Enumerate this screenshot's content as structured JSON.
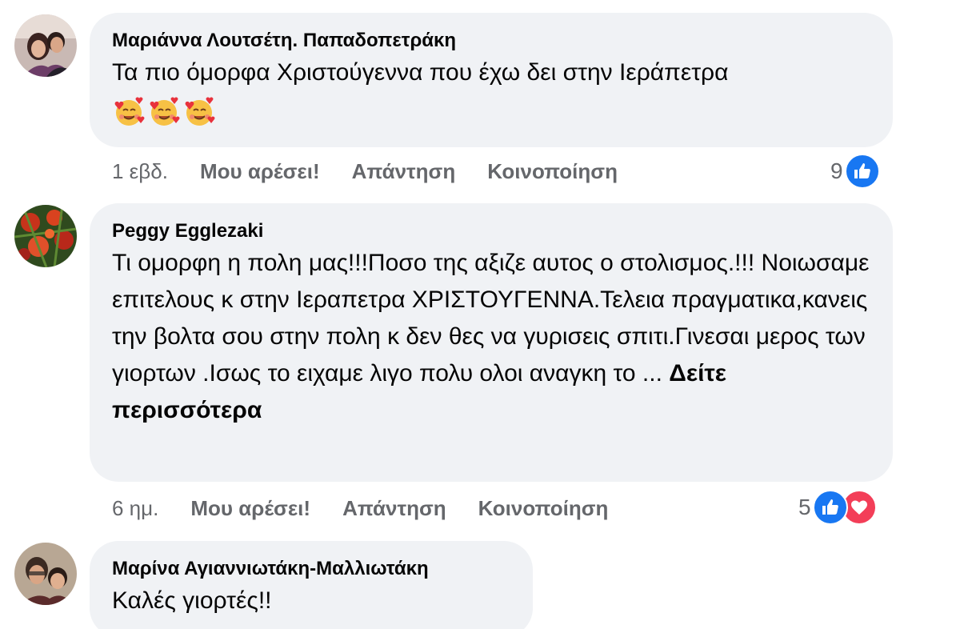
{
  "comments": [
    {
      "author": "Μαριάννα Λουτσέτη. Παπαδοπετράκη",
      "text": "Τα πιο όμορφα Χριστούγεννα που έχω δει στην Ιεράπετρα",
      "emojis": [
        "smiling-face-with-hearts",
        "smiling-face-with-hearts",
        "smiling-face-with-hearts"
      ],
      "time": "1 εβδ.",
      "like_label": "Μου αρέσει!",
      "reply_label": "Απάντηση",
      "share_label": "Κοινοποίηση",
      "reaction_count": "9",
      "reaction_icons": [
        "like-icon"
      ]
    },
    {
      "author": "Peggy Egglezaki",
      "text": "Τι ομορφη η πολη μας!!!Ποσο της αξιζε αυτος ο στολισμος.!!! Νοιωσαμε επιτελους κ στην Ιεραπετρα ΧΡΙΣΤΟΥΓΕΝΝΑ.Τελεια πραγματικα,κανεις την βολτα σου στην πολη κ δεν θες να γυρισεις σπιτι.Γινεσαι μερος των γιορτων .Ισως το ειχαμε λιγο πολυ ολοι αναγκη το ...",
      "see_more": "Δείτε περισσότερα",
      "time": "6 ημ.",
      "like_label": "Μου αρέσει!",
      "reply_label": "Απάντηση",
      "share_label": "Κοινοποίηση",
      "reaction_count": "5",
      "reaction_icons": [
        "like-icon",
        "love-icon"
      ]
    },
    {
      "author": "Μαρίνα Αγιαννιωτάκη-Μαλλιωτάκη",
      "text": "Καλές γιορτές!!"
    }
  ],
  "colors": {
    "bubble": "#f0f2f5",
    "secondary_text": "#65676b",
    "like_blue": "#1877f2",
    "love_red": "#f33e58"
  }
}
